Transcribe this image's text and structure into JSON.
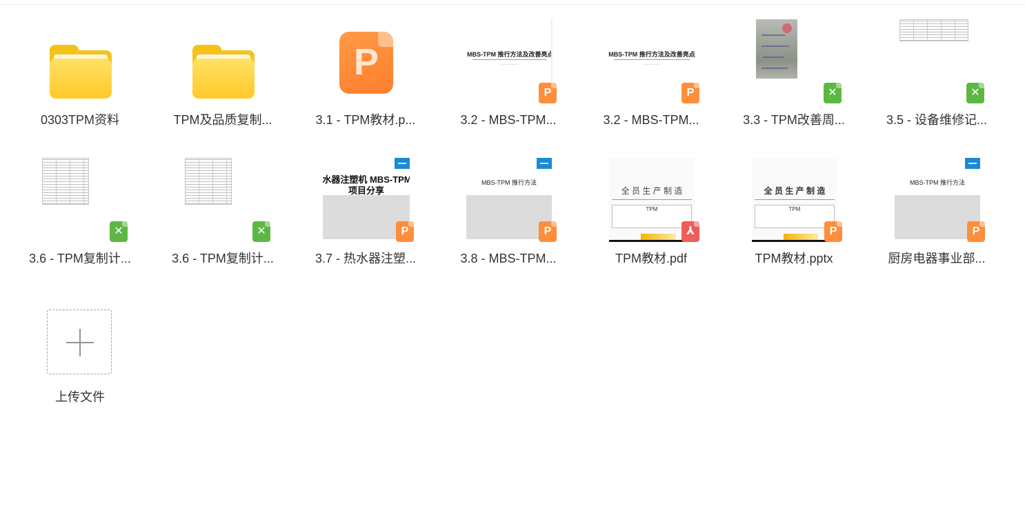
{
  "files": [
    {
      "name": "0303TPM资料",
      "type": "folder"
    },
    {
      "name": "TPM及品质复制...",
      "type": "folder"
    },
    {
      "name": "3.1 - TPM教材.p...",
      "type": "ppt",
      "icon": "ppt-file-icon"
    },
    {
      "name": "3.2 - MBS-TPM...",
      "type": "ppt",
      "preview_title": "MBS-TPM 推行方法及改善亮点"
    },
    {
      "name": "3.2 - MBS-TPM...",
      "type": "ppt",
      "preview_title": "MBS-TPM 推行方法及改善亮点"
    },
    {
      "name": "3.3 - TPM改善周...",
      "type": "xls"
    },
    {
      "name": "3.5 - 设备维修记...",
      "type": "xls"
    },
    {
      "name": "3.6 - TPM复制计...",
      "type": "xls"
    },
    {
      "name": "3.6 - TPM复制计...",
      "type": "xls"
    },
    {
      "name": "3.7 - 热水器注塑...",
      "type": "ppt",
      "preview_title": "水器注塑机 MBS-TPM",
      "preview_subtitle": "项目分享"
    },
    {
      "name": "3.8 - MBS-TPM...",
      "type": "ppt",
      "preview_title": "MBS-TPM 推行方法"
    },
    {
      "name": "TPM教材.pdf",
      "type": "pdf",
      "preview_title": "全 员 生 产 制 造",
      "preview_subtitle": "TPM"
    },
    {
      "name": "TPM教材.pptx",
      "type": "ppt",
      "preview_title": "全 员 生 产 制 造",
      "preview_subtitle": "TPM"
    },
    {
      "name": "厨房电器事业部...",
      "type": "ppt",
      "preview_title": "MBS-TPM 推行方法"
    }
  ],
  "upload": {
    "label": "上传文件"
  },
  "colors": {
    "ppt": "#ff8e3c",
    "xls": "#5cb843",
    "pdf": "#ef5c5c",
    "folder": "#ffc928"
  }
}
